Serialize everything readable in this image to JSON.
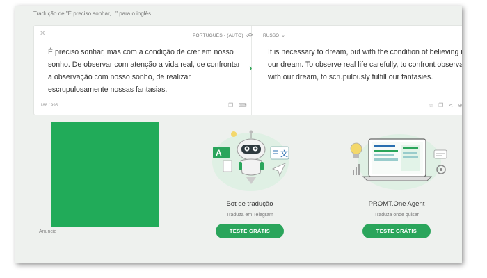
{
  "page": {
    "title": "Tradução de \"É preciso sonhar,...\" para o inglês"
  },
  "translator": {
    "source_lang": "PORTUGUÊS - (AUTO)",
    "target_lang": "RUSSO",
    "source_text": "É preciso sonhar, mas com a condição de crer em nosso sonho. De observar com atenção a vida real, de confrontar a observação com nosso sonho, de realizar escrupulosamente nossas fantasias.",
    "target_text": "It is necessary to dream, but with the condition of believing in our dream. To observe real life carefully, to confront observation with our dream, to scrupulously fulfill our fantasies.",
    "char_count": "188 / 995"
  },
  "ad": {
    "label": "Anuncie"
  },
  "promos": [
    {
      "title": "Bot de tradução",
      "subtitle": "Traduza em Telegram",
      "button": "TESTE GRÁTIS"
    },
    {
      "title": "PROMT.One Agent",
      "subtitle": "Traduza onde quiser",
      "button": "TESTE GRÁTIS"
    }
  ],
  "colors": {
    "accent": "#2aa55b",
    "ad_green": "#21ab59",
    "background": "#eef1ee"
  }
}
